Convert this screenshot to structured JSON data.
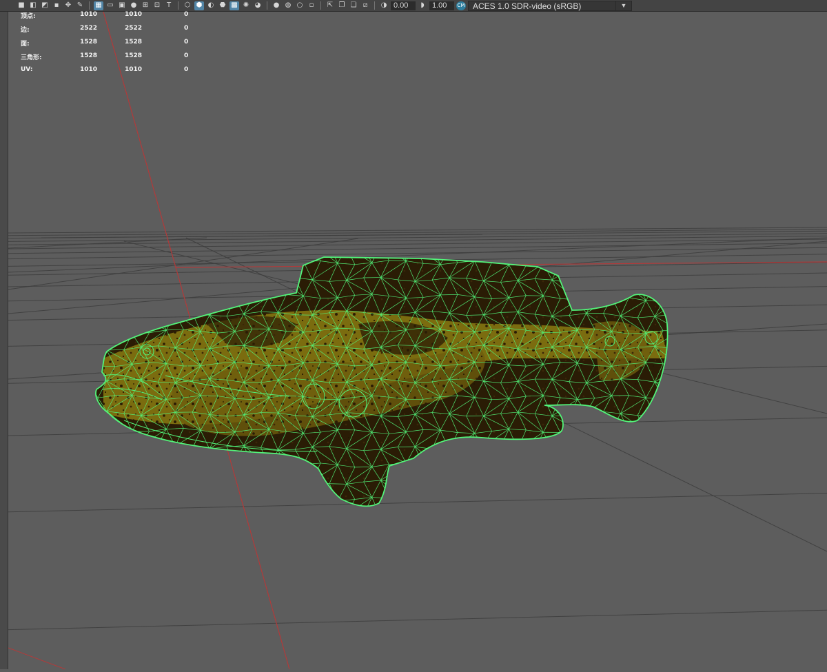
{
  "toolbar": {
    "icons": [
      "camera-icon",
      "camera-attributes-icon",
      "bookmark-camera-icon",
      "image-plane-icon",
      "pan-zoom-icon",
      "grease-pencil-icon",
      "grid-icon",
      "film-gate-icon",
      "resolution-gate-icon",
      "gate-mask-icon",
      "field-chart-icon",
      "safe-action-icon",
      "safe-title-icon",
      "wireframe-icon",
      "smooth-shade-icon",
      "default-material-icon",
      "wireframe-on-shaded-icon",
      "textured-icon",
      "use-all-lights-icon",
      "shadows-icon",
      "screen-space-ao-icon",
      "motion-blur-icon",
      "multisample-aa-icon",
      "depth-of-field-icon",
      "isolate-select-icon",
      "xray-icon",
      "xray-joints-icon",
      "backface-culling-icon",
      "exposure-icon",
      "gamma-icon",
      "color-management-icon"
    ],
    "exposure_value": "0.00",
    "gamma_value": "1.00",
    "color_space": "ACES 1.0 SDR-video (sRGB)"
  },
  "hud": {
    "rows": [
      {
        "label": "顶点:",
        "a": "1010",
        "b": "1010",
        "c": "0"
      },
      {
        "label": "边:",
        "a": "2522",
        "b": "2522",
        "c": "0"
      },
      {
        "label": "面:",
        "a": "1528",
        "b": "1528",
        "c": "0"
      },
      {
        "label": "三角形:",
        "a": "1528",
        "b": "1528",
        "c": "0"
      },
      {
        "label": "UV:",
        "a": "1010",
        "b": "1010",
        "c": "0"
      }
    ]
  },
  "colors": {
    "viewport_bg": "#5d5d5d",
    "grid_line": "#3d3d3d",
    "axis_red": "#b23a3a",
    "wire_green": "#52f47a",
    "fish_dark": "#2a1c05",
    "fish_yellow": "#8a7a12"
  }
}
